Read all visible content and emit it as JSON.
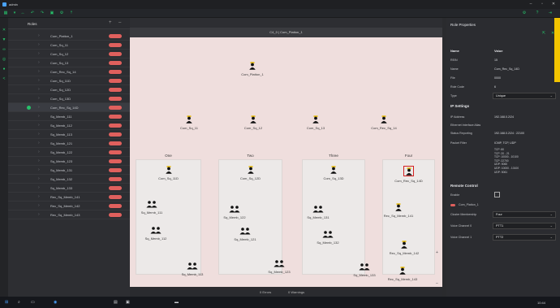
{
  "app": {
    "title": "admin"
  },
  "roles_panel": {
    "title": "Roles",
    "items": [
      {
        "label": "Com_Platton_1"
      },
      {
        "label": "Com_Sq_11"
      },
      {
        "label": "Com_Sq_12"
      },
      {
        "label": "Com_Sq_13"
      },
      {
        "label": "Com_Rec_Sq_14"
      },
      {
        "label": "Com_Sq_11D"
      },
      {
        "label": "Com_Sq_12D"
      },
      {
        "label": "Com_Sq_13D"
      },
      {
        "label": "Com_Rec_Sq_14D"
      },
      {
        "label": "Sq_Memb_111"
      },
      {
        "label": "Sq_Memb_112"
      },
      {
        "label": "Sq_Memb_113"
      },
      {
        "label": "Sq_Memb_121"
      },
      {
        "label": "Sq_Memb_122"
      },
      {
        "label": "Sq_Memb_123"
      },
      {
        "label": "Sq_Memb_131"
      },
      {
        "label": "Sq_Memb_132"
      },
      {
        "label": "Sq_Memb_133"
      },
      {
        "label": "Rec_Sq_Memb_141"
      },
      {
        "label": "Rec_Sq_Memb_142"
      },
      {
        "label": "Rec_Sq_Memb_143"
      }
    ]
  },
  "canvas": {
    "tab_title": "C4_0 | Com_Platton_1",
    "root": "Com_Platton_1",
    "commanders": [
      "Com_Sq_11",
      "Com_Sq_12",
      "Com_Sq_13",
      "Com_Rec_Sq_14"
    ],
    "groups": [
      {
        "title": "One",
        "lead": "Com_Sq_11D",
        "members": [
          "Sq_Memb_111",
          "Sq_Memb_112",
          "Sq_Memb_113"
        ]
      },
      {
        "title": "Two",
        "lead": "Com_Sq_12D",
        "members": [
          "Sq_Memb_122",
          "Sq_Memb_121",
          "Sq_Memb_123"
        ]
      },
      {
        "title": "Three",
        "lead": "Com_Sq_13D",
        "members": [
          "Sq_Memb_131",
          "Sq_Memb_132",
          "Sq_Memb_133"
        ]
      },
      {
        "title": "Four",
        "lead": "Com_Rec_Sq_14D",
        "members": [
          "Rec_Sq_Memb_141",
          "Rec_Sq_Memb_142",
          "Rec_Sq_Memb_143"
        ]
      }
    ]
  },
  "status": {
    "errors": "0 Errors",
    "warnings": "0 Warnings"
  },
  "properties": {
    "title": "Role Properties",
    "col_name": "Name",
    "col_value": "Value",
    "rows": [
      {
        "k": "REIN",
        "v": "15"
      },
      {
        "k": "Name",
        "v": "Com_Rec_Sq_14D"
      },
      {
        "k": "File",
        "v": "0000"
      },
      {
        "k": "Role Code",
        "v": "6"
      },
      {
        "k": "Type",
        "v": "Unique"
      }
    ],
    "ip_title": "IP Settings",
    "ip_rows": [
      {
        "k": "IP Address",
        "v": "192.168.0.2/24"
      },
      {
        "k": "Ethernet Interface Alias",
        "v": ""
      },
      {
        "k": "Status Reporting",
        "v": "192.168.0.2/24 : 22100"
      },
      {
        "k": "Packet Filter",
        "v": "ICMP, TCP, UDP"
      }
    ],
    "filter_lines": [
      "TCP: 80",
      "TCP: 20 - 21",
      "TCP: 10000 - 10100",
      "TCP: 22700",
      "UDP: 5060",
      "UDP: 10000 - 10100",
      "UDP: 5061"
    ],
    "remote_title": "Remote Control",
    "enable_label": "Enable",
    "remote_target": "Com_Platton_1",
    "cluster_label": "Cluster Membership",
    "cluster_value": "Four",
    "voice1_label": "Voice Channel 0",
    "voice1_value": "PTT1",
    "voice2_label": "Voice Channel 1",
    "voice2_value": "PTT2"
  },
  "taskbar": {
    "time": "10:44"
  },
  "colors": {
    "accent": "#27c06a",
    "toggle": "#e0605d",
    "canvas_bg": "#efdedd",
    "selected_border": "#d22020"
  }
}
